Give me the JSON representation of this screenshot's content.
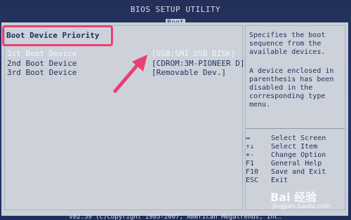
{
  "bios": {
    "title": "BIOS SETUP UTILITY",
    "tab": "Boot"
  },
  "section": {
    "heading": "Boot Device Priority"
  },
  "boot_devices": [
    {
      "label": "1st Boot Device",
      "value": "[USB:SMI USB DISK]"
    },
    {
      "label": "2nd Boot Device",
      "value": "[CDROM:3M-PIONEER D]"
    },
    {
      "label": "3rd Boot Device",
      "value": "[Removable Dev.]"
    }
  ],
  "help": {
    "text1": "Specifies the boot\nsequence from the\navailable devices.",
    "text2": "A device enclosed in\nparenthesis has been\ndisabled in the\ncorresponding type\nmenu."
  },
  "keys": [
    {
      "key": "↔",
      "desc": "Select Screen"
    },
    {
      "key": "↑↓",
      "desc": "Select Item"
    },
    {
      "key": "+-",
      "desc": "Change Option"
    },
    {
      "key": "F1",
      "desc": "General Help"
    },
    {
      "key": "F10",
      "desc": "Save and Exit"
    },
    {
      "key": "ESC",
      "desc": "Exit"
    }
  ],
  "footer": {
    "copyright": "v02.59 (C)Copyright 1985-2007, American Megatrends, Inc."
  },
  "watermark": {
    "logo": "Bai 经验",
    "url": "jingyan.baidu.com"
  },
  "colors": {
    "background": "#23305a",
    "panel": "#c9cfd7",
    "text": "#1f2f5c",
    "selected_text": "#f4f6f9",
    "annotation": "#ea3f74"
  }
}
